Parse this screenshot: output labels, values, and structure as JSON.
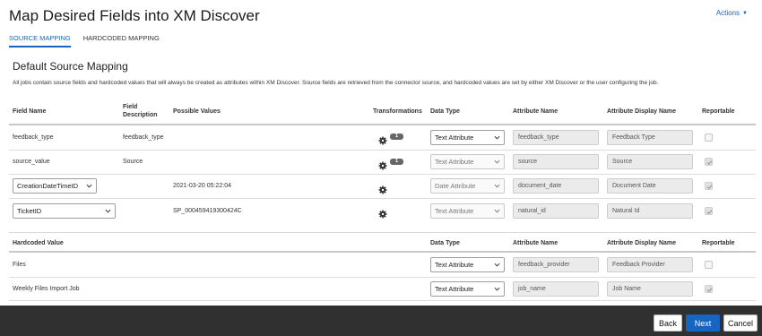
{
  "header": {
    "title": "Map Desired Fields into XM Discover",
    "actions_label": "Actions"
  },
  "tabs": [
    {
      "label": "SOURCE MAPPING",
      "active": true
    },
    {
      "label": "HARDCODED MAPPING",
      "active": false
    }
  ],
  "section": {
    "title": "Default Source Mapping",
    "description": "All jobs contain source fields and hardcoded values that will always be created as attributes within XM Discover. Source fields are retrieved from the connector source, and hardcoded values are set by either XM Discover or the user configuring the job."
  },
  "source_table": {
    "headers": {
      "field_name": "Field Name",
      "field_description": "Field Description",
      "possible_values": "Possible Values",
      "transformations": "Transformations",
      "data_type": "Data Type",
      "attribute_name": "Attribute Name",
      "attribute_display_name": "Attribute Display Name",
      "reportable": "Reportable"
    },
    "rows": [
      {
        "field_name": "feedback_type",
        "field_description": "feedback_type",
        "possible_value": "",
        "transform_count": "1",
        "data_type": "Text Attribute",
        "attribute_name": "feedback_type",
        "display_name": "Feedback Type",
        "reportable": false
      },
      {
        "field_name": "source_value",
        "field_description": "Source",
        "possible_value": "",
        "transform_count": "1",
        "data_type": "Text Attribute",
        "attribute_name": "source",
        "display_name": "Source",
        "reportable": true
      },
      {
        "field_name": "CreationDateTimeID",
        "field_description": "",
        "possible_value": "2021-03-20 05:22:04",
        "transform_count": "",
        "data_type": "Date Attribute",
        "attribute_name": "document_date",
        "display_name": "Document Date",
        "reportable": true
      },
      {
        "field_name": "TicketID",
        "field_description": "",
        "possible_value": "SP_000459419300424C",
        "transform_count": "",
        "data_type": "Text Attribute",
        "attribute_name": "natural_id",
        "display_name": "Natural Id",
        "reportable": true
      }
    ]
  },
  "hardcoded_table": {
    "headers": {
      "hardcoded_value": "Hardcoded Value",
      "data_type": "Data Type",
      "attribute_name": "Attribute Name",
      "attribute_display_name": "Attribute Display Name",
      "reportable": "Reportable"
    },
    "rows": [
      {
        "value": "Files",
        "data_type": "Text Attribute",
        "attribute_name": "feedback_provider",
        "display_name": "Feedback Provider",
        "reportable": false
      },
      {
        "value": "Weekly Files Import Job",
        "data_type": "Text Attribute",
        "attribute_name": "job_name",
        "display_name": "Job Name",
        "reportable": true
      }
    ]
  },
  "footer": {
    "back_label": "Back",
    "next_label": "Next",
    "cancel_label": "Cancel"
  },
  "icons": {
    "actions": "caret-down-icon",
    "transform": "gear-icon",
    "select": "chevron-down-icon",
    "reportable": "checkbox-icon"
  },
  "colors": {
    "accent": "#1665c1",
    "footer": "#303030"
  }
}
